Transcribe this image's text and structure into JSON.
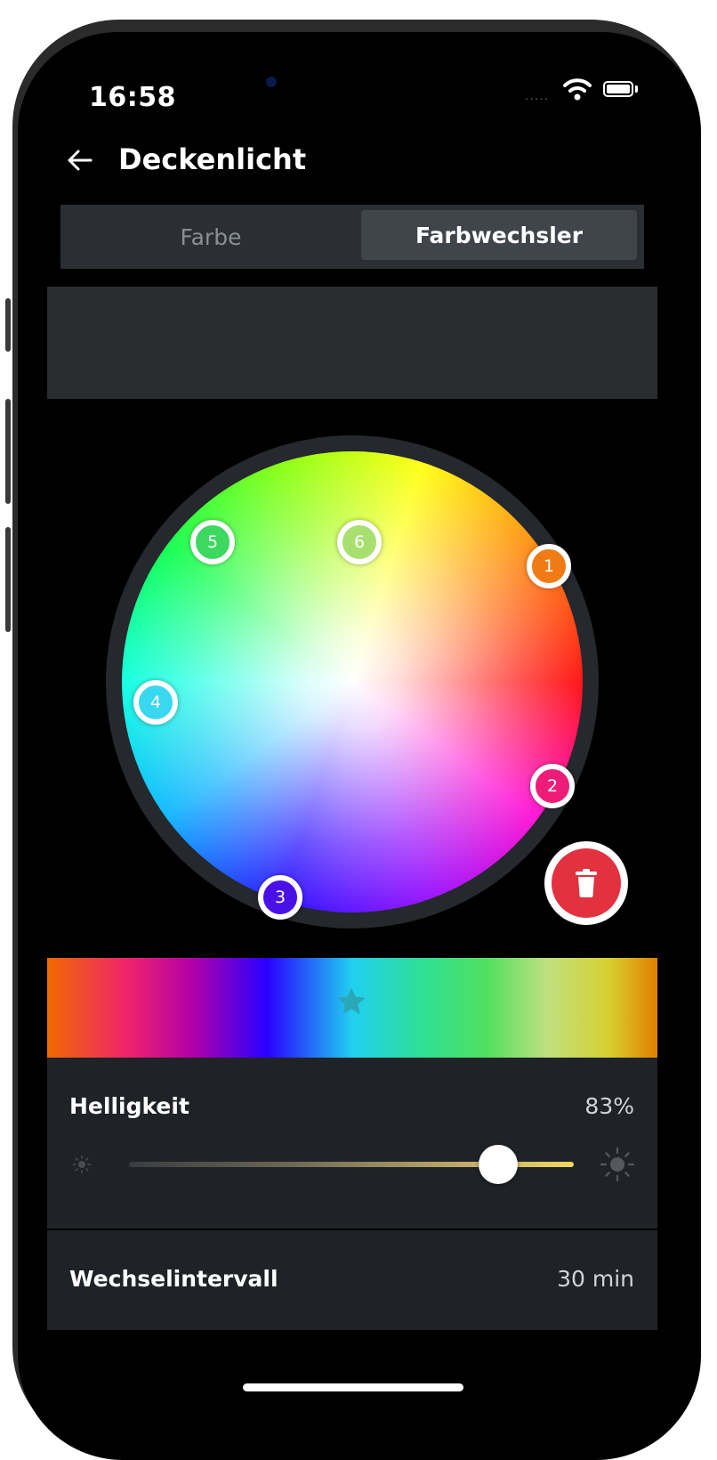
{
  "status": {
    "time": "16:58",
    "signal_dots": "....."
  },
  "header": {
    "title": "Deckenlicht",
    "back_icon": "arrow-left-icon"
  },
  "tabs": [
    {
      "label": "Farbe",
      "active": false
    },
    {
      "label": "Farbwechsler",
      "active": true
    }
  ],
  "color_markers": [
    {
      "number": "1",
      "color": "#f07a14"
    },
    {
      "number": "2",
      "color": "#ec1c78"
    },
    {
      "number": "3",
      "color": "#4a10e8"
    },
    {
      "number": "4",
      "color": "#38d8f0"
    },
    {
      "number": "5",
      "color": "#3cd860"
    },
    {
      "number": "6",
      "color": "#a8e070"
    }
  ],
  "delete_button": {
    "icon": "trash-icon",
    "color": "#e2313f"
  },
  "sequence_bar": {
    "icon": "star-icon"
  },
  "brightness": {
    "label": "Helligkeit",
    "value": "83%",
    "level": 0.83
  },
  "interval": {
    "label": "Wechselintervall",
    "value": "30 min"
  },
  "colors": {
    "accent_red": "#e2313f",
    "panel_bg": "#1f2226",
    "segment_bg": "#2b2f34"
  }
}
